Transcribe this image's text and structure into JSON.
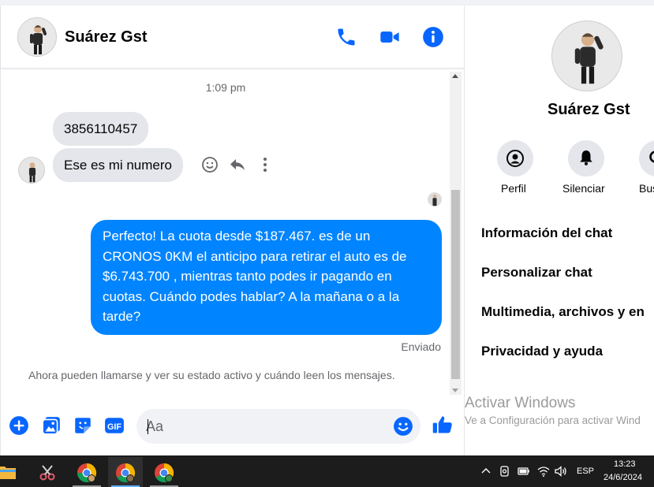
{
  "chat": {
    "contact_name": "Suárez Gst",
    "timestamp": "1:09 pm",
    "messages_in": [
      "3856110457",
      "Ese es mi numero"
    ],
    "message_out": "Perfecto! La cuota desde $187.467. es de un CRONOS 0KM el anticipo para retirar el auto es de $6.743.700 , mientras tanto podes ir pagando en cuotas. Cuándo podes hablar? A la mañana o a la tarde?",
    "sent_status": "Enviado",
    "notice": "Ahora pueden llamarse y ver su estado activo y cuándo leen los mensajes.",
    "input_placeholder": "Aa"
  },
  "info": {
    "name": "Suárez Gst",
    "actions": [
      "Perfil",
      "Silenciar",
      "Bus"
    ],
    "menu": [
      "Información del chat",
      "Personalizar chat",
      "Multimedia, archivos y en",
      "Privacidad y ayuda"
    ]
  },
  "watermark": {
    "title": "Activar Windows",
    "subtitle": "Ve a Configuración para activar Wind"
  },
  "taskbar": {
    "language": "ESP",
    "time": "13:23",
    "date": "24/6/2024"
  },
  "colors": {
    "accent": "#0084ff",
    "incoming_bubble": "#e4e6eb",
    "icon_blue": "#0866ff",
    "taskbar": "#1c1c1c"
  }
}
